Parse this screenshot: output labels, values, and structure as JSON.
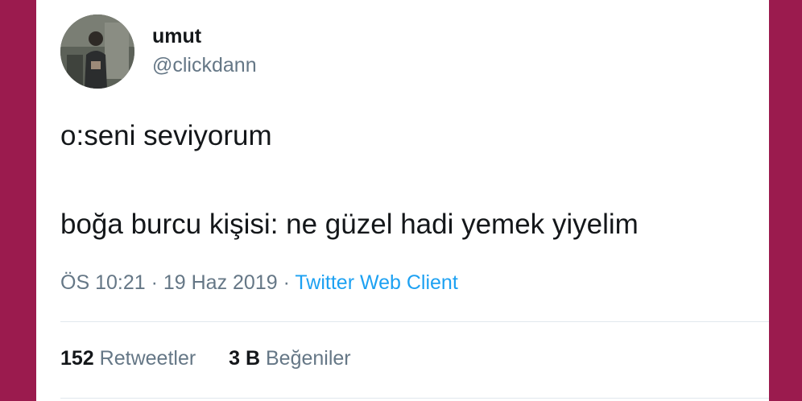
{
  "tweet": {
    "user": {
      "name": "umut",
      "handle": "@clickdann"
    },
    "lines": [
      "o:seni seviyorum",
      "boğa burcu kişisi: ne güzel hadi yemek yiyelim"
    ],
    "time": "ÖS 10:21",
    "separator": " · ",
    "date": "19 Haz 2019",
    "separator2": " · ",
    "source": "Twitter Web Client",
    "stats": {
      "retweets_count": "152",
      "retweets_label": "Retweetler",
      "likes_count": "3 B",
      "likes_label": "Beğeniler"
    }
  },
  "colors": {
    "frame": "#9b1b4e",
    "card": "#ffffff",
    "text": "#14171a",
    "muted": "#657786",
    "link": "#1da1f2",
    "divider": "#e1e8ed"
  }
}
